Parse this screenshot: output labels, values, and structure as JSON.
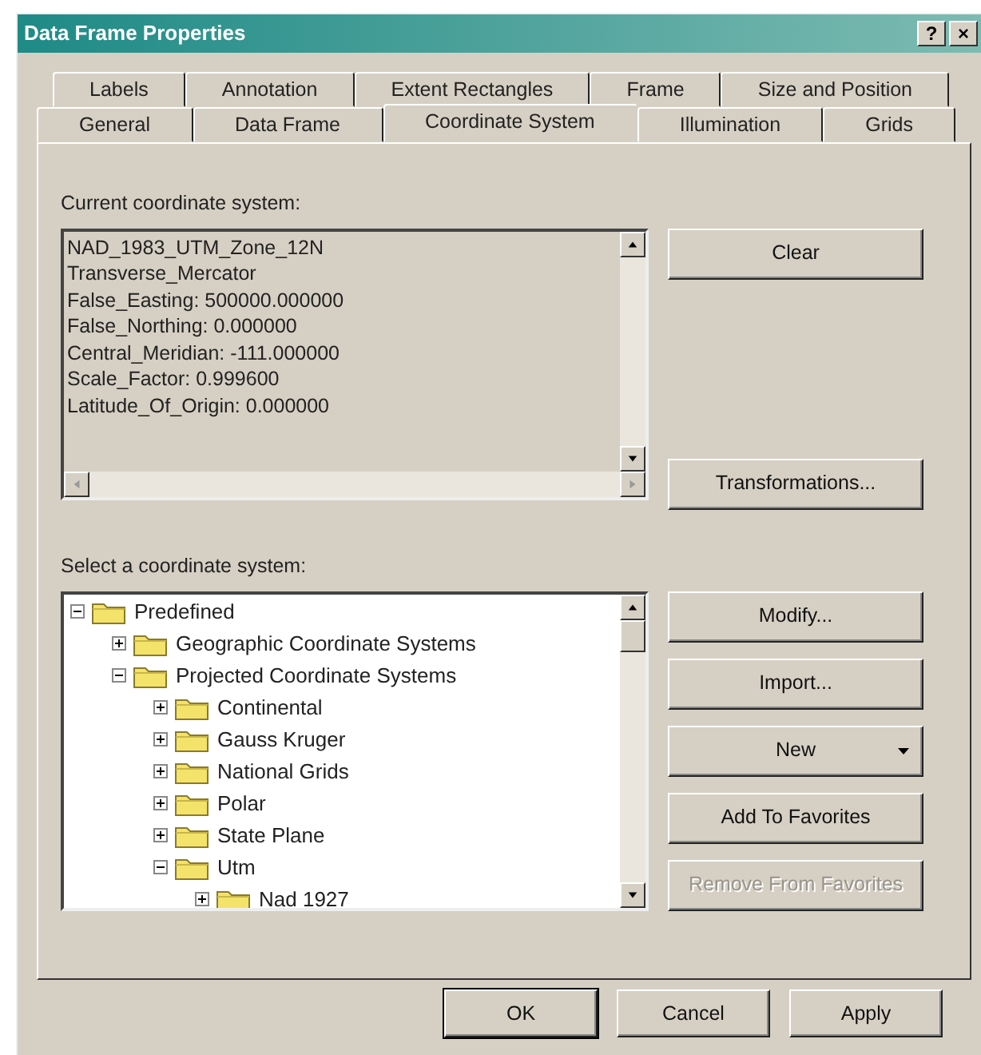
{
  "window": {
    "title": "Data Frame Properties",
    "title_buttons": [
      "?",
      "×"
    ]
  },
  "tab_rows": [
    [
      {
        "label": "Labels",
        "selected": false
      },
      {
        "label": "Annotation",
        "selected": false
      },
      {
        "label": "Extent Rectangles",
        "selected": false
      },
      {
        "label": "Frame",
        "selected": false
      },
      {
        "label": "Size and Position",
        "selected": false
      }
    ],
    [
      {
        "label": "General",
        "selected": false
      },
      {
        "label": "Data Frame",
        "selected": false
      },
      {
        "label": "Coordinate System",
        "selected": true
      },
      {
        "label": "Illumination",
        "selected": false
      },
      {
        "label": "Grids",
        "selected": false
      }
    ]
  ],
  "current_system": {
    "label": "Current coordinate system:",
    "lines": [
      "NAD_1983_UTM_Zone_12N",
      "Transverse_Mercator",
      "False_Easting: 500000.000000",
      "False_Northing: 0.000000",
      "Central_Meridian: -111.000000",
      "Scale_Factor: 0.999600",
      "Latitude_Of_Origin: 0.000000"
    ]
  },
  "current_buttons": [
    {
      "label": "Clear",
      "disabled": false
    },
    {
      "label": "Transformations...",
      "disabled": false
    }
  ],
  "select_label": "Select a coordinate system:",
  "tree": [
    {
      "label": "Predefined",
      "expanded": true,
      "children": [
        {
          "label": "Geographic Coordinate Systems",
          "expanded": false
        },
        {
          "label": "Projected Coordinate Systems",
          "expanded": true,
          "children": [
            {
              "label": "Continental",
              "expanded": false
            },
            {
              "label": "Gauss Kruger",
              "expanded": false
            },
            {
              "label": "National Grids",
              "expanded": false
            },
            {
              "label": "Polar",
              "expanded": false
            },
            {
              "label": "State Plane",
              "expanded": false
            },
            {
              "label": "Utm",
              "expanded": true,
              "children": [
                {
                  "label": "Nad 1927",
                  "expanded": false
                }
              ]
            }
          ]
        }
      ]
    }
  ],
  "select_buttons": [
    {
      "label": "Modify...",
      "disabled": false,
      "dropdown": false
    },
    {
      "label": "Import...",
      "disabled": false,
      "dropdown": false
    },
    {
      "label": "New",
      "disabled": false,
      "dropdown": true
    },
    {
      "label": "Add To Favorites",
      "disabled": false,
      "dropdown": false
    },
    {
      "label": "Remove From Favorites",
      "disabled": true,
      "dropdown": false
    }
  ],
  "dialog_buttons": [
    {
      "label": "OK",
      "default": true
    },
    {
      "label": "Cancel",
      "default": false
    },
    {
      "label": "Apply",
      "default": false
    }
  ]
}
